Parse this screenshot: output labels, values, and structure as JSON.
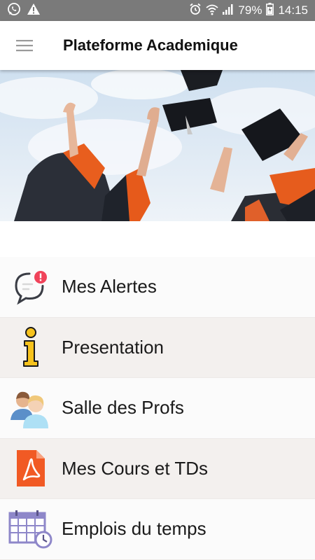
{
  "status_bar": {
    "battery": "79%",
    "time": "14:15",
    "icons": [
      "whatsapp-icon",
      "warning-icon",
      "alarm-icon",
      "wifi-icon",
      "signal-icon",
      "battery-icon"
    ]
  },
  "app_bar": {
    "title": "Plateforme Academique",
    "menu_icon": "hamburger-icon"
  },
  "banner": {
    "image": "graduation-caps-photo"
  },
  "menu": {
    "items": [
      {
        "label": "Mes Alertes",
        "icon": "alert-chat-icon"
      },
      {
        "label": "Presentation",
        "icon": "info-icon"
      },
      {
        "label": "Salle des Profs",
        "icon": "users-icon"
      },
      {
        "label": "Mes Cours et TDs",
        "icon": "pdf-icon"
      },
      {
        "label": "Emplois du temps",
        "icon": "calendar-icon"
      }
    ]
  },
  "colors": {
    "status_bar": "#7a7a7a",
    "row_light": "#fbfbfb",
    "row_dark": "#f3f0ee",
    "alert_badge": "#f0435a",
    "info_yellow": "#f7c31d",
    "pdf_orange": "#f15a24",
    "calendar_purple": "#8e87c9"
  }
}
